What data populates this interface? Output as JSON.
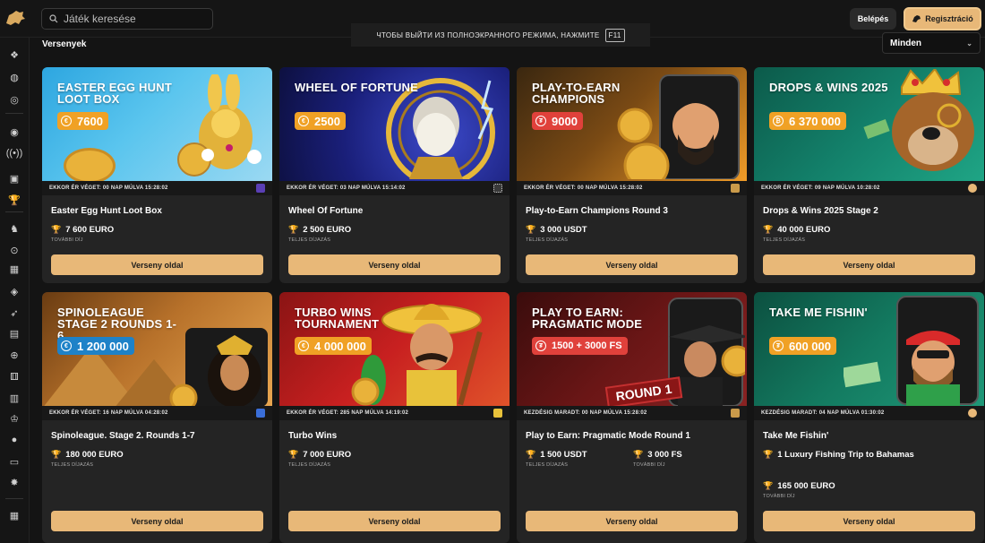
{
  "header": {
    "search_placeholder": "Játék keresése",
    "login_label": "Belépés",
    "register_label": "Regisztráció",
    "fullscreen_notice": "ЧТОБЫ ВЫЙТИ ИЗ ПОЛНОЭКРАННОГО РЕЖИМА, НАЖМИТЕ",
    "fullscreen_key": "F11"
  },
  "page": {
    "section_title": "Versenyek",
    "filter_value": "Minden"
  },
  "sidebar_icons": [
    "diamonds-icon",
    "football-icon",
    "roulette-icon",
    "live-casino-icon",
    "broadcast-icon",
    "slots-icon",
    "trophy-icon",
    "racing-icon",
    "live-icon",
    "grid-icon",
    "poker-chip-icon",
    "rocket-icon",
    "card-icon",
    "globe-icon",
    "dice-icon",
    "shop-icon",
    "cup-icon",
    "ball-icon",
    "bus-icon",
    "star-icon",
    "apps-icon"
  ],
  "cards": [
    {
      "banner_title": "EASTER EGG HUNT LOOT BOX",
      "prize_pill": "7600",
      "timer": "EKKOR ÉR VÉGET: 00 NAP MÚLVA 15:28:02",
      "name": "Easter Egg Hunt Loot Box",
      "prizes": [
        {
          "value": "7 600 EURO",
          "label": "TOVÁBBI DÍJ"
        }
      ],
      "cta": "Verseny oldal"
    },
    {
      "banner_title": "WHEEL OF FORTUNE",
      "prize_pill": "2500",
      "timer": "EKKOR ÉR VÉGET: 03 NAP MÚLVA 15:14:02",
      "name": "Wheel Of Fortune",
      "prizes": [
        {
          "value": "2 500 EURO",
          "label": "TELJES DÍJAZÁS"
        }
      ],
      "cta": "Verseny oldal"
    },
    {
      "banner_title": "PLAY-TO-EARN CHAMPIONS",
      "prize_pill": "9000",
      "timer": "EKKOR ÉR VÉGET: 00 NAP MÚLVA 15:28:02",
      "name": "Play-to-Earn Champions Round 3",
      "prizes": [
        {
          "value": "3 000 USDT",
          "label": "TELJES DÍJAZÁS"
        }
      ],
      "cta": "Verseny oldal"
    },
    {
      "banner_title": "DROPS & WINS 2025",
      "prize_pill": "6 370 000",
      "timer": "EKKOR ÉR VÉGET: 09 NAP MÚLVA 10:28:02",
      "name": "Drops & Wins 2025 Stage 2",
      "prizes": [
        {
          "value": "40 000 EURO",
          "label": "TELJES DÍJAZÁS"
        }
      ],
      "cta": "Verseny oldal"
    },
    {
      "banner_title": "SPINOLEAGUE STAGE 2 ROUNDS 1-6",
      "prize_pill": "1 200 000",
      "timer": "EKKOR ÉR VÉGET: 16 NAP MÚLVA 04:28:02",
      "name": "Spinoleague. Stage 2. Rounds 1-7",
      "prizes": [
        {
          "value": "180 000 EURO",
          "label": "TELJES DÍJAZÁS"
        }
      ],
      "cta": "Verseny oldal"
    },
    {
      "banner_title": "TURBO WINS TOURNAMENT",
      "prize_pill": "4 000 000",
      "timer": "EKKOR ÉR VÉGET: 285 NAP MÚLVA 14:19:02",
      "name": "Turbo Wins",
      "prizes": [
        {
          "value": "7 000 EURO",
          "label": "TELJES DÍJAZÁS"
        }
      ],
      "cta": "Verseny oldal"
    },
    {
      "banner_title": "PLAY TO EARN: PRAGMATIC MODE",
      "prize_pill": "1500 + 3000 FS",
      "banner_extra": "ROUND 1",
      "timer": "KEZDÉSIG MARADT: 00 NAP MÚLVA 15:28:02",
      "name": "Play to Earn: Pragmatic Mode Round 1",
      "prizes": [
        {
          "value": "1 500 USDT",
          "label": "TELJES DÍJAZÁS"
        },
        {
          "value": "3 000 FS",
          "label": "TOVÁBBI DÍJ"
        }
      ],
      "cta": "Verseny oldal"
    },
    {
      "banner_title": "TAKE ME FISHIN'",
      "prize_pill": "600 000",
      "timer": "KEZDÉSIG MARADT: 04 NAP MÚLVA 01:30:02",
      "name": "Take Me Fishin'",
      "prizes": [
        {
          "value": "1 Luxury Fishing Trip to Bahamas",
          "label": ""
        },
        {
          "value": "165 000 EURO",
          "label": "TOVÁBBI DÍJ"
        }
      ],
      "cta": "Verseny oldal"
    }
  ],
  "colors": {
    "accent": "#e8b878",
    "background": "#141414",
    "card": "#242424",
    "pill_orange": "#f0a125",
    "pill_red": "#e0413b",
    "pill_blue": "#1e82c8"
  }
}
